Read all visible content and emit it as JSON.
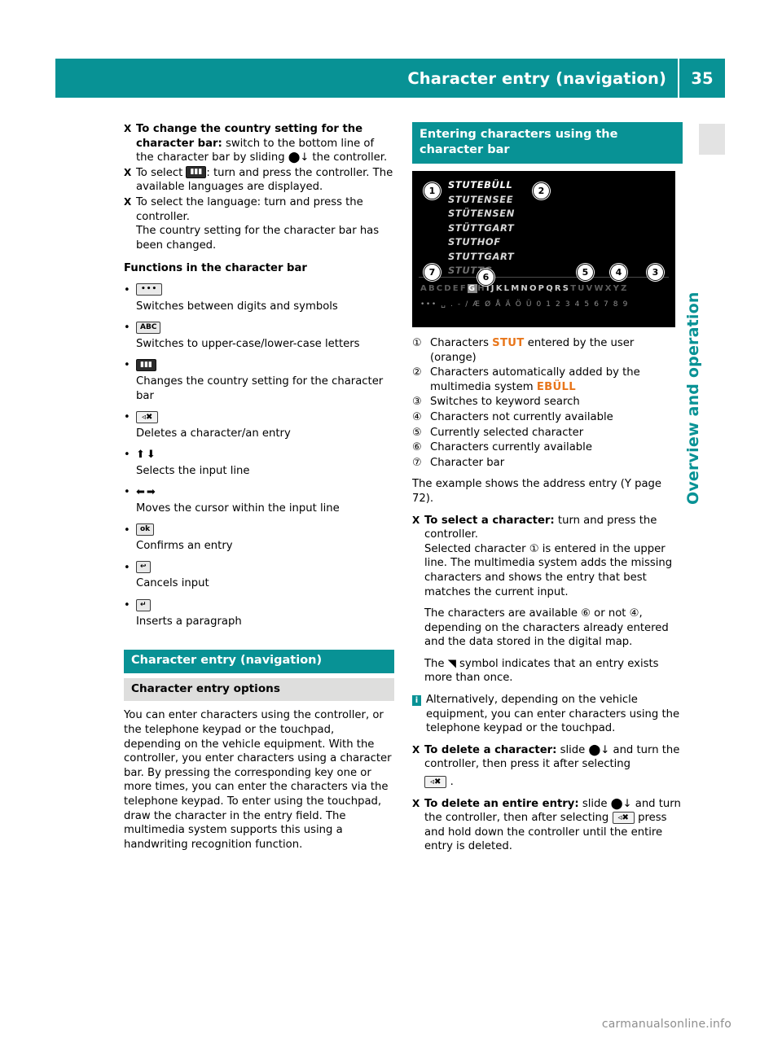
{
  "header": {
    "title": "Character entry (navigation)",
    "page_number": "35"
  },
  "side_label": "Overview and operation",
  "left_column": {
    "steps": [
      {
        "marker": "X",
        "lead": "To change the country setting for the character bar:",
        "rest": " switch to the bottom line of the character bar by sliding ",
        "glyph": "⬤↓",
        "tail": " the controller."
      },
      {
        "marker": "X",
        "lead": "",
        "rest": "To select ",
        "glyph": "flag-icon",
        "tail": ": turn and press the controller. The available languages are displayed."
      },
      {
        "marker": "X",
        "lead": "",
        "rest": "To select the language: turn and press the controller.",
        "glyph": "",
        "tail": "The country setting for the character bar has been changed."
      }
    ],
    "functions_heading": "Functions in the character bar",
    "functions": [
      {
        "key_label": "•••",
        "key_type": "dots",
        "desc": "Switches between digits and symbols"
      },
      {
        "key_label": "ABC",
        "key_type": "text",
        "desc": "Switches to upper-case/lower-case letters"
      },
      {
        "key_label": "flag",
        "key_type": "flag",
        "desc": "Changes the country setting for the character bar"
      },
      {
        "key_label": "delete",
        "key_type": "del",
        "desc": "Deletes a character/an entry"
      },
      {
        "key_label": "⬆⬇",
        "key_type": "arrows-vert",
        "desc": "Selects the input line"
      },
      {
        "key_label": "⬅➡",
        "key_type": "arrows-horz",
        "desc": "Moves the cursor within the input line"
      },
      {
        "key_label": "ok",
        "key_type": "ok",
        "desc": "Confirms an entry"
      },
      {
        "key_label": "↩",
        "key_type": "back",
        "desc": "Cancels input"
      },
      {
        "key_label": "↲",
        "key_type": "enter",
        "desc": "Inserts a paragraph"
      }
    ],
    "section_bar_teal": "Character entry (navigation)",
    "section_bar_grey": "Character entry options",
    "body_paragraph": "You can enter characters using the controller, or the telephone keypad or the touchpad, depending on the vehicle equipment. With the controller, you enter characters using a character bar. By pressing the corresponding key one or more times, you can enter the characters via the telephone keypad. To enter using the touchpad, draw the character in the entry field. The multimedia system supports this using a handwriting recognition function."
  },
  "right_column": {
    "heading": "Entering characters using the character bar",
    "figure": {
      "list_items": [
        "STUTEBÜLL",
        "STUTENSEE",
        "STÜTENSEN",
        "STÜTTGART",
        "STUTHOF",
        "STUTTGART",
        "STUTTG"
      ],
      "alpha_row": "ABCDEFGHIJKLMNOPQRSTUVWXYZ",
      "selected_letter": "G",
      "symbol_row": "••• ␣ . - / Æ Ø Å Ä Ö Ü 0 1 2 3 4 5 6 7 8 9",
      "callouts": [
        "1",
        "2",
        "3",
        "4",
        "5",
        "6",
        "7"
      ]
    },
    "legend": [
      {
        "num": "①",
        "pre": "Characters ",
        "kw": "STUT",
        "post": " entered by the user (orange)"
      },
      {
        "num": "②",
        "pre": "Characters automatically added by the multimedia system ",
        "kw": "EBÜLL",
        "post": ""
      },
      {
        "num": "③",
        "pre": "Switches to keyword search",
        "kw": "",
        "post": ""
      },
      {
        "num": "④",
        "pre": "Characters not currently available",
        "kw": "",
        "post": ""
      },
      {
        "num": "⑤",
        "pre": "Currently selected character",
        "kw": "",
        "post": ""
      },
      {
        "num": "⑥",
        "pre": "Characters currently available",
        "kw": "",
        "post": ""
      },
      {
        "num": "⑦",
        "pre": "Character bar",
        "kw": "",
        "post": ""
      }
    ],
    "example_text": "The example shows the address entry (Y page 72).",
    "steps": [
      {
        "lead": "To select a character:",
        "rest": " turn and press the controller.",
        "extra": "Selected character ① is entered in the upper line. The multimedia system adds the missing characters and shows the entry that best matches the current input.",
        "extra2": "The characters are available ⑥ or not ④, depending on the characters already entered and the data stored in the digital map.",
        "extra3": "The ◥ symbol indicates that an entry exists more than once."
      }
    ],
    "note": "Alternatively, depending on the vehicle equipment, you can enter characters using the telephone keypad or the touchpad.",
    "delete_char_step": {
      "lead": "To delete a character:",
      "rest": " slide ⬤↓ and turn the controller, then press it after selecting"
    },
    "delete_entry_step": {
      "lead": "To delete an entire entry:",
      "rest": " slide ⬤↓ and turn the controller, then after selecting",
      "tail": "press and hold down the controller until the entire entry is deleted."
    }
  },
  "watermark": "carmanualsonline.info"
}
